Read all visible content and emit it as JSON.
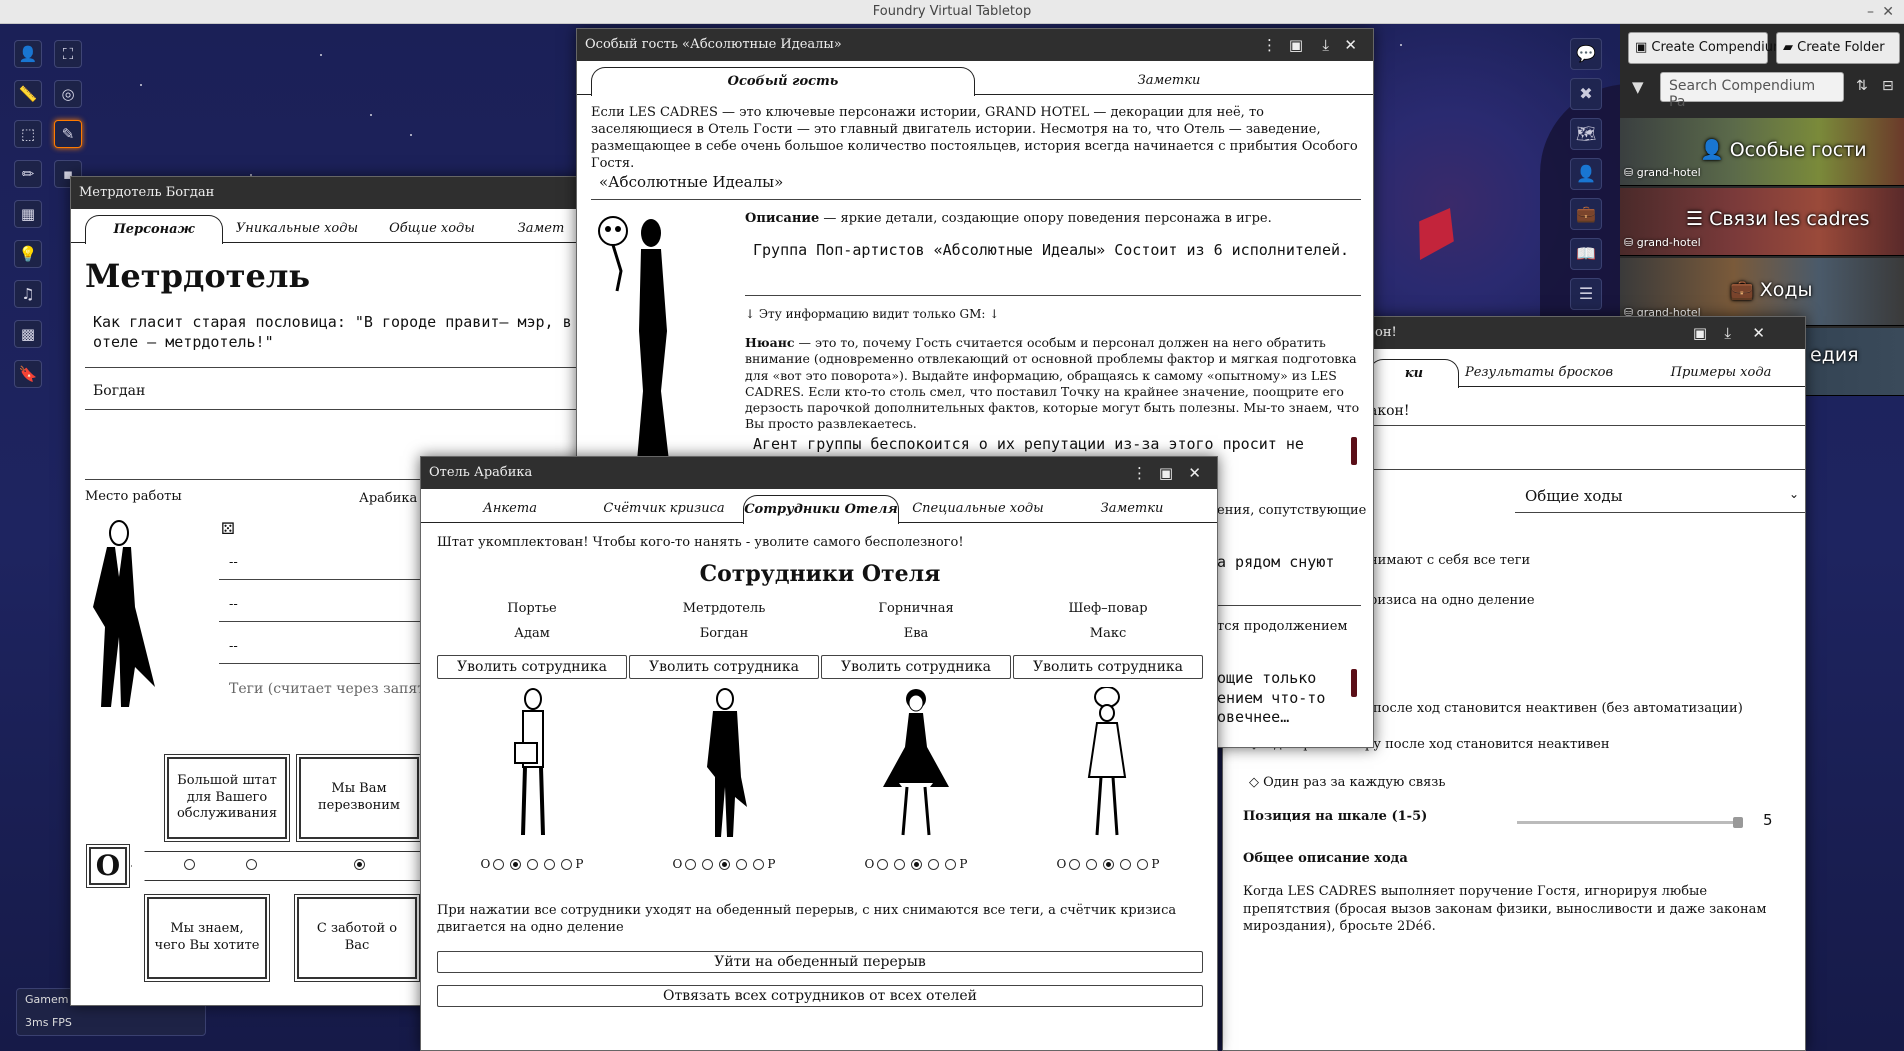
{
  "os": {
    "title": "Foundry Virtual Tabletop",
    "min": "–",
    "close": "✕"
  },
  "sidebar": {
    "create_compendium": "Create Compendium",
    "create_folder": "Create Folder",
    "search_placeholder": "Search Compendium Pa",
    "packs": [
      {
        "label": "Особые гости",
        "tag": "grand-hotel"
      },
      {
        "label": "Связи les cadres",
        "tag": "grand-hotel"
      },
      {
        "label": "Ходы",
        "tag": "grand-hotel"
      },
      {
        "label": "едия",
        "tag": ""
      }
    ]
  },
  "guest": {
    "title": "Особый гость «Абсолютные Идеалы»",
    "tabs": [
      "Особый гость",
      "Заметки"
    ],
    "intro": "Если LES CADRES — это ключевые персонажи истории, GRAND HOTEL — декорации для неё, то заселяющиеся в Отель Гости — это главный двигатель истории. Несмотря на то, что Отель — заведение, размещающее в себе очень большое количество постояльцев, история всегда начинается с прибытия Особого Гостя.",
    "name": "«Абсолютные Идеалы»",
    "desc_label": "Описание",
    "desc_hint": " — яркие детали, создающие опору поведения персонажа в игре.",
    "desc_value": "Группа Поп-артистов «Абсолютные Идеалы» Состоит из 6 исполнителей.",
    "gm_note": "↓ Эту информацию видит только GM: ↓",
    "nuance_label": "Нюанс",
    "nuance_text": " — это то, почему Гость считается особым и персонал должен на него обратить внимание (одновременно отвлекающий от основной проблемы фактор и мягкая подготовка для «вот это поворота»). Выдайте информацию, обращаясь к самому «опытному» из LES CADRES. Если кто-то столь смел, что поставил Точку на крайнее значение, поощрите его дерзость парочкой дополнительных фактов, которые могут быть полезны. Мы-то знаем, что Вы просто развлекаетесь.",
    "nuance_value": "Агент группы беспокоится о их репутации из-за этого просит не",
    "frag1": "ения, сопутствующие",
    "frag2": "а рядом снуют",
    "frag3": "тся продолжением",
    "frag4": "ощие только\nением что-то\nовечнее…"
  },
  "maitre": {
    "title": "Метрдотель Богдан",
    "tabs": [
      "Персонаж",
      "Уникальные ходы",
      "Общие ходы",
      "Замет"
    ],
    "heading": "Метрдотель",
    "quote": "Как гласит старая пословица: \"В городе правит— мэр, в отеле — метрдотель!\"",
    "name_value": "Богдан",
    "workplace_label": "Место работы",
    "workplace_value": "Арабика",
    "dash1": "--",
    "dash2": "--",
    "dash3": "--",
    "tags_note": "Теги (считает через запят",
    "boxes": [
      "Большой штат для Вашего обслуживания",
      "Мы Вам перезвоним",
      "Мы знаем, чего Вы хотите",
      "С заботой о Вас"
    ],
    "o_label": "O"
  },
  "moves": {
    "title": "он!",
    "tabs": [
      "ки",
      "Результаты бросков",
      "Примеры хода"
    ],
    "line1": "акон!",
    "select_value": "Общие ходы",
    "opt1": "нимают с себя все теги",
    "opt2": "ризиса на одно деление",
    "opt3": "после ход становится неактивен (без автоматизации)",
    "opt4": "Один раз за игру после ход становится неактивен",
    "opt5": "Один раз за каждую связь",
    "scale_label": "Позиция на шкале (1-5)",
    "scale_value": "5",
    "scale_fraction": 1.0,
    "desc_heading": "Общее описание хода",
    "desc_text": "Когда LES CADRES выполняет поручение Гостя, игнорируя любые препятствия (бросая вызов законам физики, выносливости и даже законам мироздания), бросьте 2Dé6."
  },
  "hotel": {
    "title": "Отель Арабика",
    "tabs": [
      "Анкета",
      "Счётчик кризиса",
      "Сотрудники Отеля",
      "Специальные ходы",
      "Заметки"
    ],
    "notice": "Штат укомплектован! Чтобы кого-то нанять - уволите самого бесполезного!",
    "heading": "Сотрудники Отеля",
    "staff": [
      {
        "role": "Портье",
        "name": "Адам",
        "fire": "Уволить сотрудника",
        "level": 2
      },
      {
        "role": "Метрдотель",
        "name": "Богдан",
        "fire": "Уволить сотрудника",
        "level": 3
      },
      {
        "role": "Горничная",
        "name": "Ева",
        "fire": "Уволить сотрудника",
        "level": 3
      },
      {
        "role": "Шеф–повар",
        "name": "Макс",
        "fire": "Уволить сотрудника",
        "level": 3
      }
    ],
    "scale_left": "O",
    "scale_right": "P",
    "lunch_note": "При нажатии все сотрудники уходят на обеденный перерыв, с них снимаются все теги, а счётчик кризиса двигается на одно деление",
    "lunch_btn": "Уйти на обеденный перерыв",
    "unbind_btn": "Отвязать всех сотрудников от всех отелей"
  },
  "players": {
    "label": "Gamem",
    "sub": "3ms  FPS"
  }
}
